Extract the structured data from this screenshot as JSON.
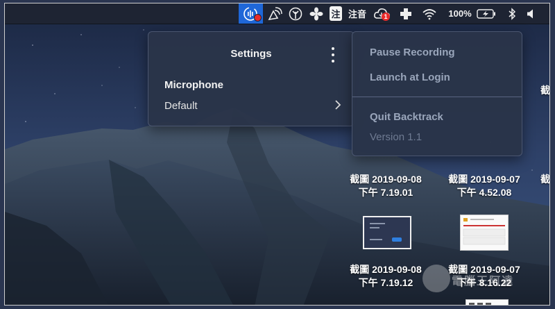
{
  "menubar": {
    "hanzi_icon_char": "注",
    "input_method_label": "注音",
    "notification_count": "1",
    "battery_text": "100%",
    "colors": {
      "bar": "#1e2433",
      "active_app": "#1f67d8",
      "badge": "#e82b2b"
    }
  },
  "settings": {
    "title": "Settings",
    "section_label": "Microphone",
    "device_value": "Default"
  },
  "menu": {
    "items": [
      "Pause Recording",
      "Launch at Login",
      "Quit Backtrack"
    ],
    "version": "Version 1.1"
  },
  "desktop": {
    "files": [
      {
        "date": "截圖 2019-09-08",
        "time": "下午 7.19.01"
      },
      {
        "date": "截圖 2019-09-07",
        "time": "下午 4.52.08"
      },
      {
        "date": "截圖 2019-09-08",
        "time": "下午 7.19.12"
      },
      {
        "date": "截圖 2019-09-07",
        "time": "下午 8.16.22"
      }
    ],
    "cutoff_char": "截"
  },
  "watermark": "電腦王阿達"
}
